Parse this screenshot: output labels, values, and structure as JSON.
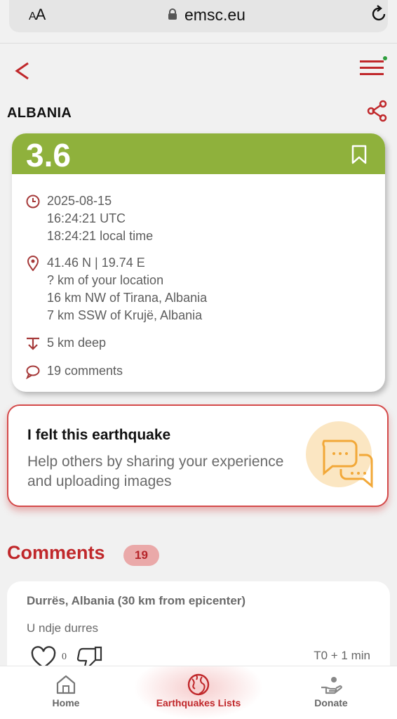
{
  "browser": {
    "text_size_label_small": "A",
    "text_size_label_large": "A",
    "url": "emsc.eu"
  },
  "header": {
    "title": "ALBANIA"
  },
  "quake": {
    "magnitude": "3.6",
    "date": "2025-08-15",
    "time_utc": "16:24:21 UTC",
    "time_local": "18:24:21 local time",
    "coordinates": "41.46 N | 19.74 E",
    "distance_you": "? km of your location",
    "distance_1": "16 km NW of Tirana, Albania",
    "distance_2": "7 km SSW of Krujë, Albania",
    "depth": "5 km deep",
    "comments": "19  comments"
  },
  "felt": {
    "title": "I felt this earthquake",
    "description": "Help others by sharing your experience and uploading images"
  },
  "comments_section": {
    "heading": "Comments",
    "count": "19",
    "items": [
      {
        "location": "Durrës, Albania (30 km from epicenter)",
        "text": "U ndje durres",
        "likes": "0",
        "time": "T0 + 1 min"
      }
    ]
  },
  "nav": {
    "items": [
      {
        "label": "Home",
        "icon": "home-icon"
      },
      {
        "label": "Earthquakes Lists",
        "icon": "globe-icon"
      },
      {
        "label": "Donate",
        "icon": "donate-hand-icon"
      }
    ],
    "active": "Earthquakes Lists"
  },
  "colors": {
    "accent": "#c0282b",
    "magnitude_bar": "#8fb13c",
    "notification_dot": "#2e9e3e"
  }
}
